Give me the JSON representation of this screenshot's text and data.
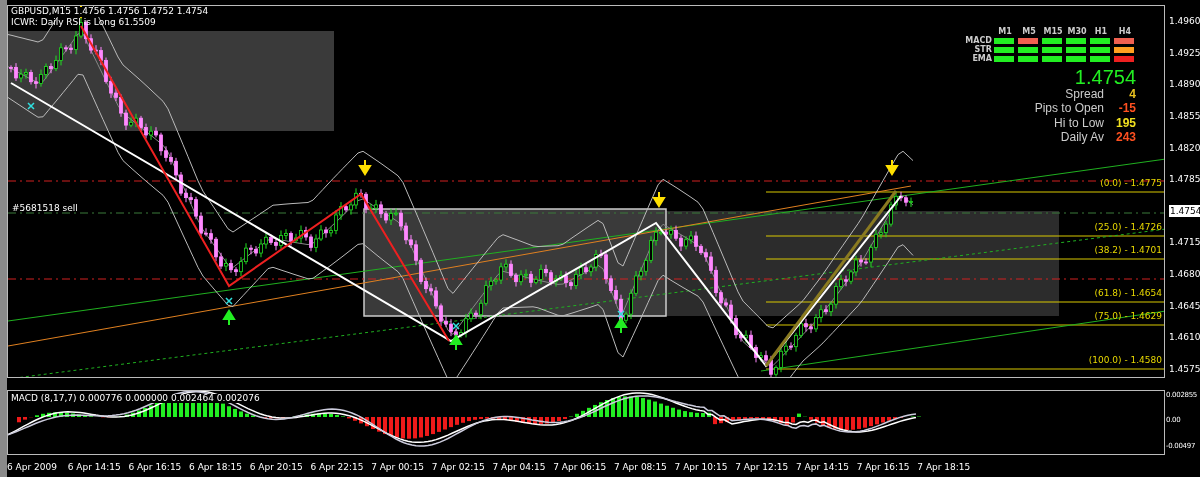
{
  "chart": {
    "symbol_line": "GBPUSD,M15  1.4756 1.4756 1.4752 1.4754",
    "indicator_line": "ICWR: Daily RSI is Long 61.5509",
    "order_label": "#5681518 sell",
    "fib_levels": [
      {
        "label": "(0.0) - 1.4775"
      },
      {
        "label": "(25.0) - 1.4726"
      },
      {
        "label": "(38.2) - 1.4701"
      },
      {
        "label": "(61.8) - 1.4654"
      },
      {
        "label": "(75.0) - 1.4629"
      },
      {
        "label": "(100.0) - 1.4580"
      }
    ],
    "price_axis": [
      {
        "kind": "tick",
        "label": "1.4960"
      },
      {
        "kind": "tick",
        "label": "1.4925"
      },
      {
        "kind": "tick",
        "label": "1.4890"
      },
      {
        "kind": "tick",
        "label": "1.4855"
      },
      {
        "kind": "tick",
        "label": "1.4820"
      },
      {
        "kind": "tick",
        "label": "1.4785"
      },
      {
        "kind": "current",
        "label": "1.4754"
      },
      {
        "kind": "tick",
        "label": "1.4715"
      },
      {
        "kind": "tick",
        "label": "1.4680"
      },
      {
        "kind": "tick",
        "label": "1.4645"
      },
      {
        "kind": "tick",
        "label": "1.4610"
      },
      {
        "kind": "tick",
        "label": "1.4575"
      }
    ]
  },
  "signal_panel": {
    "timeframes": [
      "M1",
      "M5",
      "M15",
      "M30",
      "H1",
      "H4"
    ],
    "rows": [
      {
        "label": "MACD",
        "cells": [
          {
            "color": "#22ee22"
          },
          {
            "color": "#f06050"
          },
          {
            "color": "#22ee22"
          },
          {
            "color": "#22ee22"
          },
          {
            "color": "#22ee22"
          },
          {
            "color": "#f06050"
          }
        ]
      },
      {
        "label": "STR",
        "cells": [
          {
            "color": "#22ee22"
          },
          {
            "color": "#22ee22"
          },
          {
            "color": "#22ee22"
          },
          {
            "color": "#22ee22"
          },
          {
            "color": "#22ee22"
          },
          {
            "color": "#ffa020"
          }
        ]
      },
      {
        "label": "EMA",
        "cells": [
          {
            "color": "#22ee22"
          },
          {
            "color": "#22ee22"
          },
          {
            "color": "#22ee22"
          },
          {
            "color": "#22ee22"
          },
          {
            "color": "#22ee22"
          },
          {
            "color": "#ee2020"
          }
        ]
      }
    ],
    "price": "1.4754",
    "stats": [
      {
        "label": "Spread",
        "value": "4",
        "color": "#e8c020"
      },
      {
        "label": "Pips to Open",
        "value": "-15",
        "color": "#ff5020"
      },
      {
        "label": "Hi to Low",
        "value": "195",
        "color": "#f0e020"
      },
      {
        "label": "Daily Av",
        "value": "243",
        "color": "#ff5020"
      }
    ]
  },
  "macd": {
    "label": "MACD  (8,17,7) 0.000776 0.000000 0.002464 0.002076",
    "axis": [
      "0.002855",
      "0.00",
      "-0.00497"
    ]
  },
  "time_axis": [
    "6 Apr 2009",
    "6 Apr 14:15",
    "6 Apr 16:15",
    "6 Apr 18:15",
    "6 Apr 20:15",
    "6 Apr 22:15",
    "7 Apr 00:15",
    "7 Apr 02:15",
    "7 Apr 04:15",
    "7 Apr 06:15",
    "7 Apr 08:15",
    "7 Apr 10:15",
    "7 Apr 12:15",
    "7 Apr 14:15",
    "7 Apr 16:15",
    "7 Apr 18:15"
  ]
}
